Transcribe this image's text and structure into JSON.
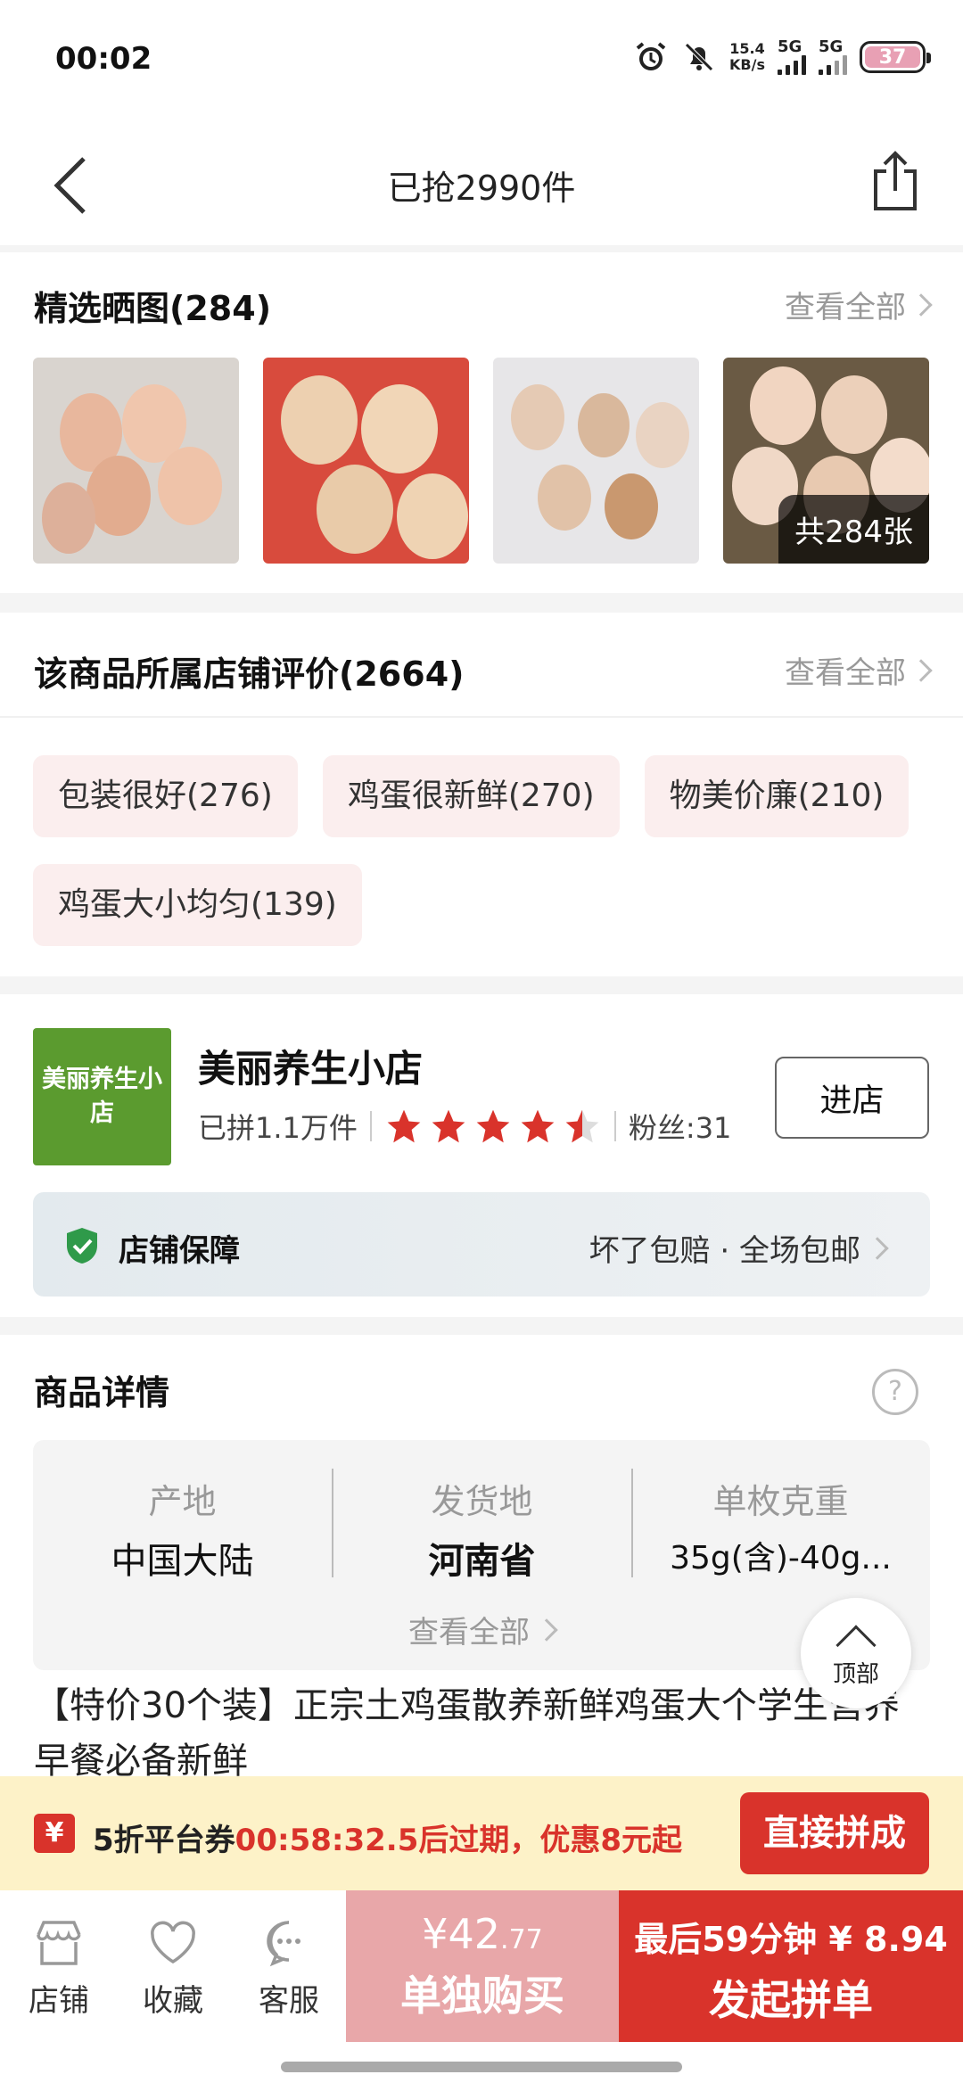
{
  "status": {
    "time": "00:02",
    "net_speed_value": "15.4",
    "net_speed_unit": "KB/s",
    "sim1": "5G",
    "sim2": "5G",
    "battery": "37"
  },
  "nav": {
    "title": "已抢2990件"
  },
  "photos": {
    "title": "精选晒图(284)",
    "more": "查看全部",
    "count_label": "共284张"
  },
  "reviews": {
    "title": "该商品所属店铺评价(2664)",
    "more": "查看全部",
    "tags": [
      "包装很好(276)",
      "鸡蛋很新鲜(270)",
      "物美价廉(210)",
      "鸡蛋大小均匀(139)"
    ]
  },
  "shop": {
    "logo_text": "美丽养生小店",
    "name": "美丽养生小店",
    "sold": "已拼1.1万件",
    "rating": 4.5,
    "fans": "粉丝:31",
    "enter": "进店",
    "guarantee_label": "店铺保障",
    "guarantee_text": "坏了包赔 · 全场包邮"
  },
  "detail": {
    "title": "商品详情",
    "help": "?",
    "attrs": [
      {
        "key": "产地",
        "value": "中国大陆"
      },
      {
        "key": "发货地",
        "value": "河南省"
      },
      {
        "key": "单枚克重",
        "value": "35g(含)-40g..."
      }
    ],
    "more": "查看全部",
    "description": "【特价30个装】正宗土鸡蛋散养新鲜鸡蛋大个学生营养早餐必备新鲜"
  },
  "top_button": "顶部",
  "coupon": {
    "icon": "¥",
    "prefix": "5折平台券",
    "time": "00:58:32.5",
    "suffix": "后过期，优惠8元起",
    "button": "直接拼成"
  },
  "bottom": {
    "tabs": [
      {
        "label": "店铺",
        "icon": "store-icon"
      },
      {
        "label": "收藏",
        "icon": "heart-icon"
      },
      {
        "label": "客服",
        "icon": "chat-icon"
      }
    ],
    "single_currency": "¥",
    "single_price_int": "42",
    "single_price_dec": ".77",
    "single_label": "单独购买",
    "group_top": "最后59分钟 ¥ 8.94",
    "group_label": "发起拼单"
  },
  "colors": {
    "accent": "#d9332b",
    "shop_green": "#5b9b2f",
    "tag_bg": "#fbeeee",
    "coupon_bg": "#fdf2c8"
  }
}
